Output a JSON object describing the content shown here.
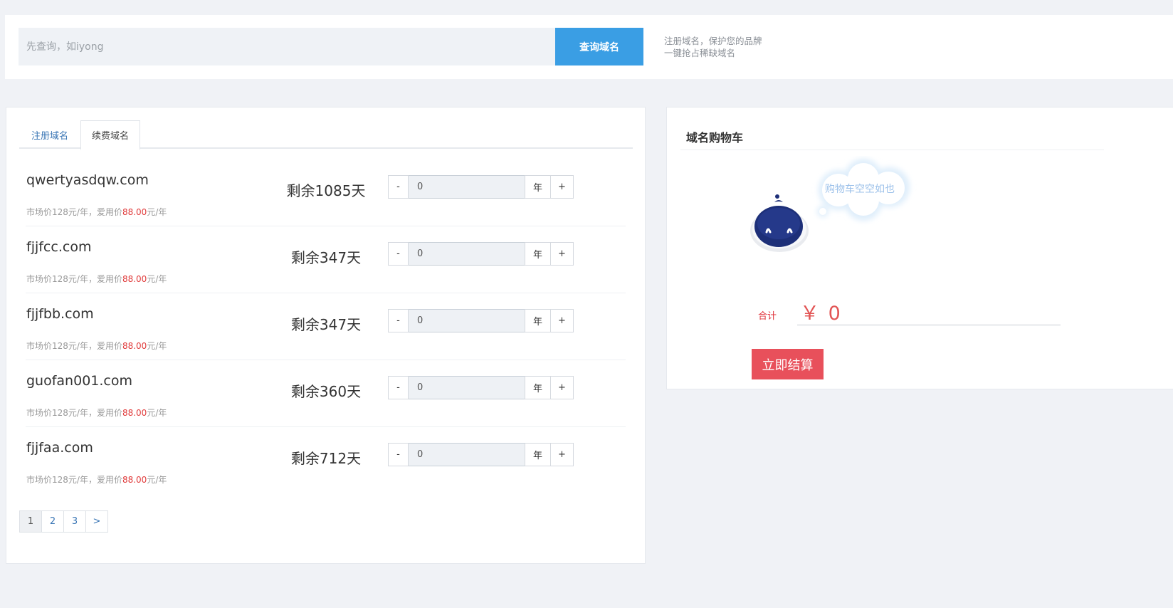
{
  "search": {
    "placeholder": "先查询，如iyong",
    "button_label": "查询域名",
    "slogan_line1": "注册域名，保护您的品牌",
    "slogan_line2": "一键抢占稀缺域名"
  },
  "tabs": [
    {
      "label": "注册域名",
      "active": false
    },
    {
      "label": "续费域名",
      "active": true
    }
  ],
  "domains": [
    {
      "name": "qwertyasdqw.com",
      "price_prefix": "市场价128元/年，爱用价",
      "price_highlight": "88.00",
      "price_suffix": "元/年",
      "remaining": "剩余1085天",
      "qty": "0",
      "unit": "年",
      "minus": "-",
      "plus": "+"
    },
    {
      "name": "fjjfcc.com",
      "price_prefix": "市场价128元/年，爱用价",
      "price_highlight": "88.00",
      "price_suffix": "元/年",
      "remaining": "剩余347天",
      "qty": "0",
      "unit": "年",
      "minus": "-",
      "plus": "+"
    },
    {
      "name": "fjjfbb.com",
      "price_prefix": "市场价128元/年，爱用价",
      "price_highlight": "88.00",
      "price_suffix": "元/年",
      "remaining": "剩余347天",
      "qty": "0",
      "unit": "年",
      "minus": "-",
      "plus": "+"
    },
    {
      "name": "guofan001.com",
      "price_prefix": "市场价128元/年，爱用价",
      "price_highlight": "88.00",
      "price_suffix": "元/年",
      "remaining": "剩余360天",
      "qty": "0",
      "unit": "年",
      "minus": "-",
      "plus": "+"
    },
    {
      "name": "fjjfaa.com",
      "price_prefix": "市场价128元/年，爱用价",
      "price_highlight": "88.00",
      "price_suffix": "元/年",
      "remaining": "剩余712天",
      "qty": "0",
      "unit": "年",
      "minus": "-",
      "plus": "+"
    }
  ],
  "pagination": [
    "1",
    "2",
    "3",
    ">"
  ],
  "cart": {
    "title": "域名购物车",
    "empty_text": "购物车空空如也",
    "total_label": "合计",
    "total_value": "￥ 0",
    "checkout_label": "立即结算"
  },
  "colors": {
    "accent_blue": "#3a9ee4",
    "price_red": "#e03a3a",
    "checkout_red": "#e8505b",
    "link_blue": "#3a76b5"
  }
}
